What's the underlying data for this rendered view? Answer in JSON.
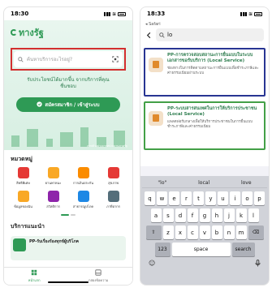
{
  "left_screen": {
    "status": {
      "time": "18:30"
    },
    "logo_text": "ทางรัฐ",
    "search": {
      "placeholder": "ค้นหาบริการอะไรอยู่?"
    },
    "hero_text_line1": "รับประโยชน์ได้มากขึ้น จากบริการที่คุณ",
    "hero_text_line2": "ชื่นชอบ",
    "register_label": "สมัครสมาชิก / เข้าสู่ระบบ",
    "hero_note": "ภาพตัวอย่างจากหน่วยงานภาครัฐ",
    "category_title": "หมวดหมู่",
    "categories": [
      {
        "label": "สิทธิพิเศษ",
        "color": "#e53935"
      },
      {
        "label": "ยานพาหนะ",
        "color": "#f9a825"
      },
      {
        "label": "การเงินประกัน",
        "color": "#fb8c00"
      },
      {
        "label": "สุขภาพ",
        "color": "#e53935"
      },
      {
        "label": "ข้อมูลของฉัน",
        "color": "#f9a825"
      },
      {
        "label": "สวัสดิการ",
        "color": "#8e24aa"
      },
      {
        "label": "สาธารณูปโภค",
        "color": "#1e88e5"
      },
      {
        "label": "ภาษีอากร",
        "color": "#546e7a"
      }
    ],
    "recommended_title": "บริการแนะนำ",
    "recommended_card": "PP-รับเรื่องร้องทุกข์ผู้บริโภค",
    "tabs": [
      {
        "label": "หน้าแรก",
        "icon": "home-icon"
      },
      {
        "label": "กล่องข้อความ",
        "icon": "inbox-icon"
      }
    ]
  },
  "right_screen": {
    "status": {
      "time": "18:33"
    },
    "back_app": "◂ Safari",
    "search_value": "lo",
    "results": [
      {
        "title": "PP-การตรวจสอบสถานะการยื่นแบบในระบบเอกสารขอรับบริการ (Local Service)",
        "description": "ช่องทางในการติดตามสถานะการยื่นแบบเพื่อชำระภาษีและค่าธรรมเนียมผ่านระบบ"
      },
      {
        "title": "PP-ระบบสารสนเทศในการให้บริการประชาชน (Local Service)",
        "description": "แพลตฟอร์มกลางเพื่อให้บริการประชาชนในการยื่นแบบชำระภาษีและค่าธรรมเนียม"
      }
    ],
    "keyboard": {
      "suggestions": [
        "\"lo\"",
        "local",
        "love"
      ],
      "row1": [
        "q",
        "w",
        "e",
        "r",
        "t",
        "y",
        "u",
        "i",
        "o",
        "p"
      ],
      "row2": [
        "a",
        "s",
        "d",
        "f",
        "g",
        "h",
        "j",
        "k",
        "l"
      ],
      "row3": [
        "z",
        "x",
        "c",
        "v",
        "b",
        "n",
        "m"
      ],
      "shift": "⇧",
      "delete": "⌫",
      "numbers": "123",
      "emoji": "☺",
      "space": "space",
      "go": "search"
    }
  }
}
